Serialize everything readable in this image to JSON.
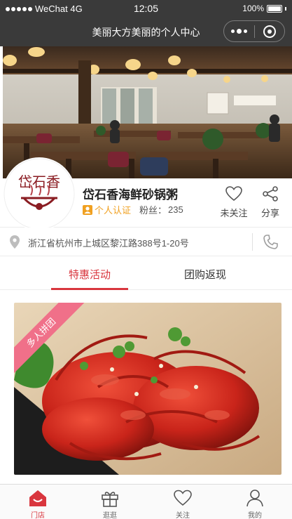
{
  "status_bar": {
    "carrier": "WeChat 4G",
    "time": "12:05",
    "battery": "100%"
  },
  "nav": {
    "title": "美丽大方美丽的个人中心"
  },
  "store": {
    "name": "岱石香海鲜砂锅粥",
    "cert_label": "个人认证",
    "fans_label": "粉丝：",
    "fans_count": "235",
    "logo_text": "岱石香",
    "follow_label": "未关注",
    "share_label": "分享"
  },
  "address": {
    "text": "浙江省杭州市上城区黎江路388号1-20号"
  },
  "tabs": [
    {
      "label": "特惠活动",
      "active": true
    },
    {
      "label": "团购返现",
      "active": false
    }
  ],
  "promo": {
    "ribbon_label": "多人拼团"
  },
  "tabbar": [
    {
      "label": "门店",
      "icon": "home-icon",
      "active": true
    },
    {
      "label": "逛逛",
      "icon": "gift-icon",
      "active": false
    },
    {
      "label": "关注",
      "icon": "heart-icon",
      "active": false
    },
    {
      "label": "我的",
      "icon": "user-icon",
      "active": false
    }
  ],
  "colors": {
    "accent": "#d9363e",
    "cert": "#f0a020",
    "ribbon": "#f07089",
    "header": "#3a3a3a"
  }
}
